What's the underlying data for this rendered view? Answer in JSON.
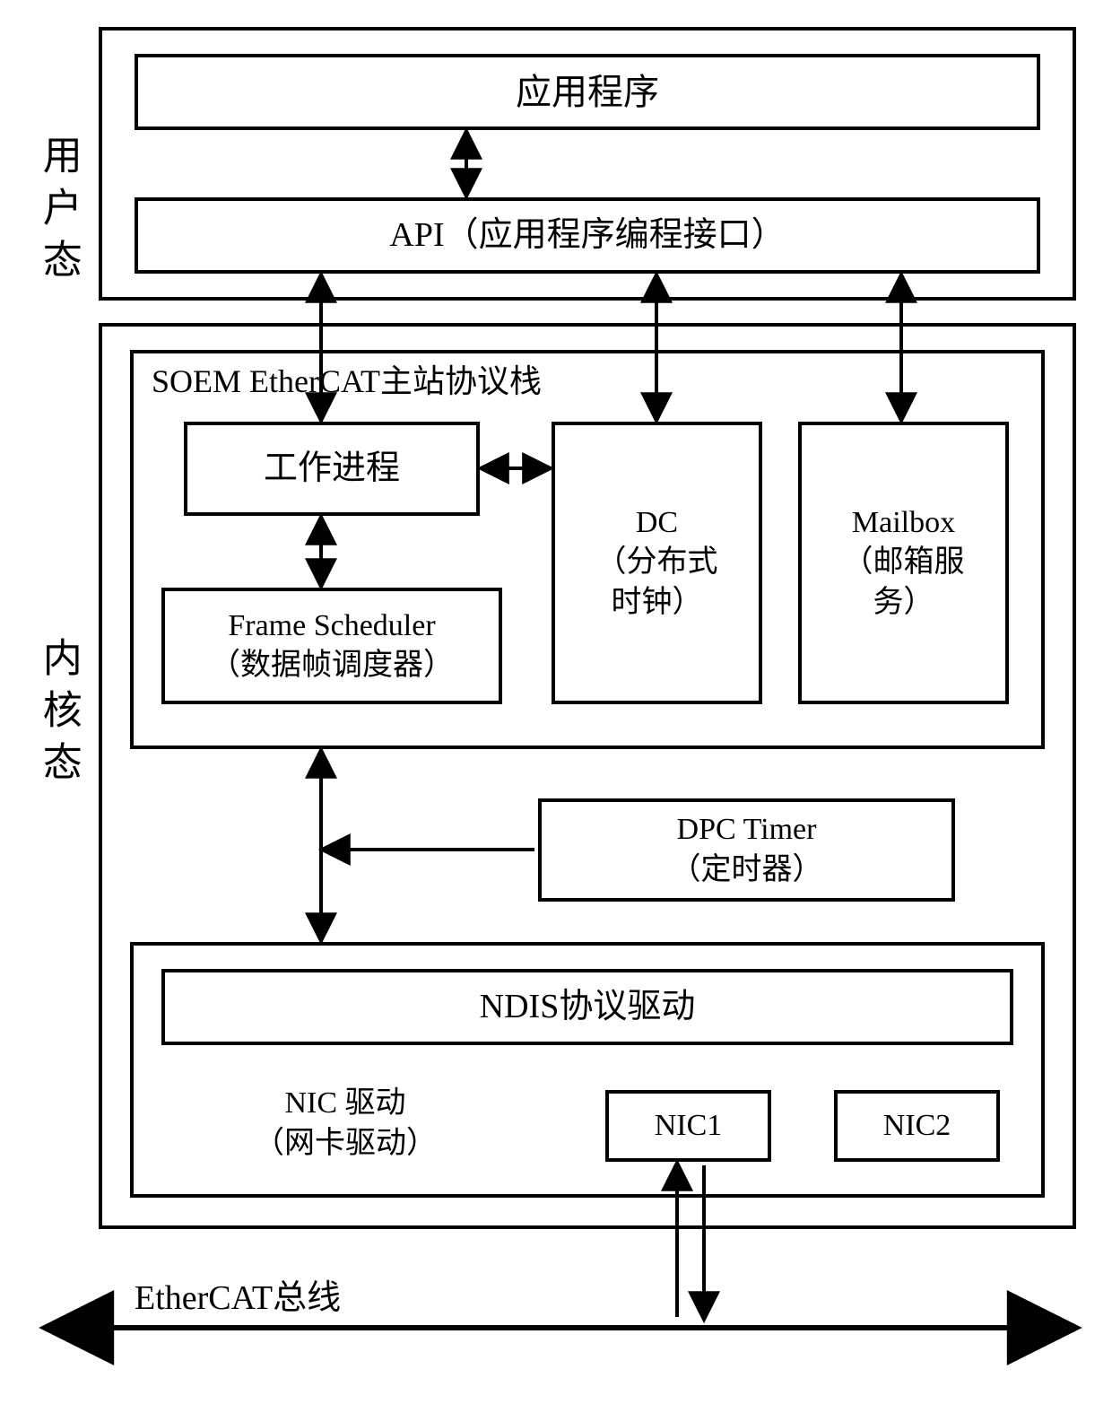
{
  "labels": {
    "user_mode": "用户态",
    "kernel_mode": "内核态"
  },
  "user": {
    "app": "应用程序",
    "api": "API（应用程序编程接口）"
  },
  "kernel": {
    "stack_title": "SOEM EtherCAT主站协议栈",
    "work_process": "工作进程",
    "frame_scheduler_l1": "Frame Scheduler",
    "frame_scheduler_l2": "（数据帧调度器）",
    "dc_l1": "DC",
    "dc_l2": "（分布式",
    "dc_l3": "时钟）",
    "mailbox_l1": "Mailbox",
    "mailbox_l2": "（邮箱服",
    "mailbox_l3": "务）",
    "dpc_l1": "DPC Timer",
    "dpc_l2": "（定时器）",
    "ndis": "NDIS协议驱动",
    "nic_driver_l1": "NIC 驱动",
    "nic_driver_l2": "（网卡驱动）",
    "nic1": "NIC1",
    "nic2": "NIC2"
  },
  "bus": "EtherCAT总线",
  "chart_data": {
    "type": "diagram",
    "title": "SOEM EtherCAT Master Architecture",
    "nodes": [
      {
        "id": "user_mode_group",
        "label": "用户态",
        "children": [
          "app",
          "api"
        ]
      },
      {
        "id": "app",
        "label": "应用程序"
      },
      {
        "id": "api",
        "label": "API（应用程序编程接口）"
      },
      {
        "id": "kernel_mode_group",
        "label": "内核态",
        "children": [
          "soem_stack",
          "dpc_timer",
          "nic_driver_group"
        ]
      },
      {
        "id": "soem_stack",
        "label": "SOEM EtherCAT主站协议栈",
        "children": [
          "work_process",
          "frame_scheduler",
          "dc",
          "mailbox"
        ]
      },
      {
        "id": "work_process",
        "label": "工作进程"
      },
      {
        "id": "frame_scheduler",
        "label": "Frame Scheduler（数据帧调度器）"
      },
      {
        "id": "dc",
        "label": "DC（分布式时钟）"
      },
      {
        "id": "mailbox",
        "label": "Mailbox（邮箱服务）"
      },
      {
        "id": "dpc_timer",
        "label": "DPC Timer（定时器）"
      },
      {
        "id": "nic_driver_group",
        "label": "NIC 驱动（网卡驱动）",
        "children": [
          "ndis",
          "nic1",
          "nic2"
        ]
      },
      {
        "id": "ndis",
        "label": "NDIS协议驱动"
      },
      {
        "id": "nic1",
        "label": "NIC1"
      },
      {
        "id": "nic2",
        "label": "NIC2"
      },
      {
        "id": "ethercat_bus",
        "label": "EtherCAT总线"
      }
    ],
    "edges": [
      {
        "from": "app",
        "to": "api",
        "dir": "both"
      },
      {
        "from": "api",
        "to": "work_process",
        "dir": "both"
      },
      {
        "from": "api",
        "to": "dc",
        "dir": "both"
      },
      {
        "from": "api",
        "to": "mailbox",
        "dir": "both"
      },
      {
        "from": "work_process",
        "to": "dc",
        "dir": "both"
      },
      {
        "from": "work_process",
        "to": "frame_scheduler",
        "dir": "both"
      },
      {
        "from": "frame_scheduler",
        "to": "ndis",
        "dir": "both"
      },
      {
        "from": "dpc_timer",
        "to": "frame_scheduler_to_ndis_link",
        "dir": "to"
      },
      {
        "from": "nic1",
        "to": "ethercat_bus",
        "dir": "both"
      }
    ]
  }
}
